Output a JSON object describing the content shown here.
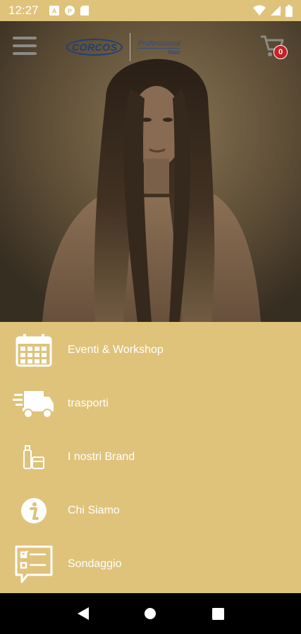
{
  "status_bar": {
    "time": "12:27"
  },
  "header": {
    "logo_brand": "CORCOS",
    "logo_line1": "Professional",
    "logo_line2": "Hair",
    "cart_count": "0"
  },
  "menu": {
    "items": [
      {
        "label": "Eventi & Workshop",
        "icon": "calendar-icon"
      },
      {
        "label": "trasporti",
        "icon": "delivery-truck-icon"
      },
      {
        "label": "I nostri Brand",
        "icon": "products-icon"
      },
      {
        "label": "Chi Siamo",
        "icon": "info-icon"
      },
      {
        "label": "Sondaggio",
        "icon": "survey-icon"
      }
    ]
  },
  "colors": {
    "accent": "#dfc37b",
    "badge": "#c62128",
    "brand_blue": "#1f3f7a"
  }
}
